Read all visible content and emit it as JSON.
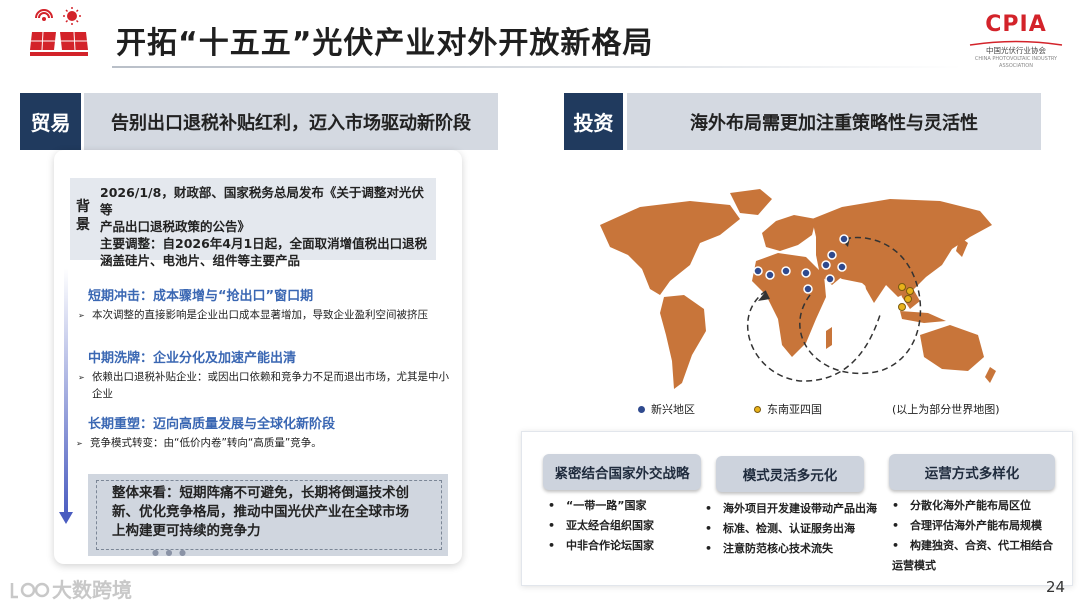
{
  "header": {
    "title": "开拓“十五五”光伏产业对外开放新格局",
    "org_logo_text": "CPIA",
    "org_logo_sub": "中国光伏行业协会",
    "org_logo_sub2": "CHINA PHOTOVOLTAIC INDUSTRY ASSOCIATION"
  },
  "left": {
    "tag": "贸易",
    "heading": "告别出口退税补贴红利，迈入市场驱动新阶段",
    "background_label": "背景",
    "background_lines": [
      "2026/1/8，财政部、国家税务总局发布《关于调整对光伏等",
      "产品出口退税政策的公告》",
      "主要调整：自2026年4月1日起，全面取消增值税出口退税",
      "涵盖硅片、电池片、组件等主要产品"
    ],
    "stages": [
      {
        "title": "短期冲击：成本骤增与“抢出口”窗口期",
        "points": [
          "本次调整的直接影响是企业出口成本显著增加，导致企业盈利空间被挤压"
        ]
      },
      {
        "title": "中期洗牌：企业分化及加速产能出清",
        "points": [
          "依赖出口退税补贴企业：或因出口依赖和竞争力不足而退出市场，尤其是中小",
          "企业"
        ]
      },
      {
        "title": "长期重塑：迈向高质量发展与全球化新阶段",
        "points": [
          "竞争模式转变：由“低价内卷”转向“高质量”竞争。"
        ]
      }
    ],
    "summary_lines": [
      "整体来看：短期阵痛不可避免，长期将倒逼技术创",
      "新、优化竞争格局，推动中国光伏产业在全球市场",
      "上构建更可持续的竞争力"
    ]
  },
  "right": {
    "tag": "投资",
    "heading": "海外布局需更加注重策略性与灵活性",
    "legend": {
      "emerging": "新兴地区",
      "sea": "东南亚四国",
      "note": "(以上为部分世界地图)"
    },
    "colors": {
      "land": "#c8753a",
      "emerging_dot": "#2f4a8e",
      "sea_dot": "#e8b21a"
    },
    "columns": [
      {
        "title": "紧密结合国家外交战略",
        "items": [
          "“一带一路”国家",
          "亚太经合组织国家",
          "中非合作论坛国家"
        ]
      },
      {
        "title": "模式灵活多元化",
        "items": [
          "海外项目开发建设带动产品出海",
          "标准、检测、认证服务出海",
          "注意防范核心技术流失"
        ]
      },
      {
        "title": "运营方式多样化",
        "items": [
          "分散化海外产能布局区位",
          "合理评估海外产能布局规模",
          "构建独资、合资、代工相结合",
          "运营模式"
        ]
      }
    ]
  },
  "footer": {
    "page": "24",
    "watermark": "大数跨境"
  }
}
